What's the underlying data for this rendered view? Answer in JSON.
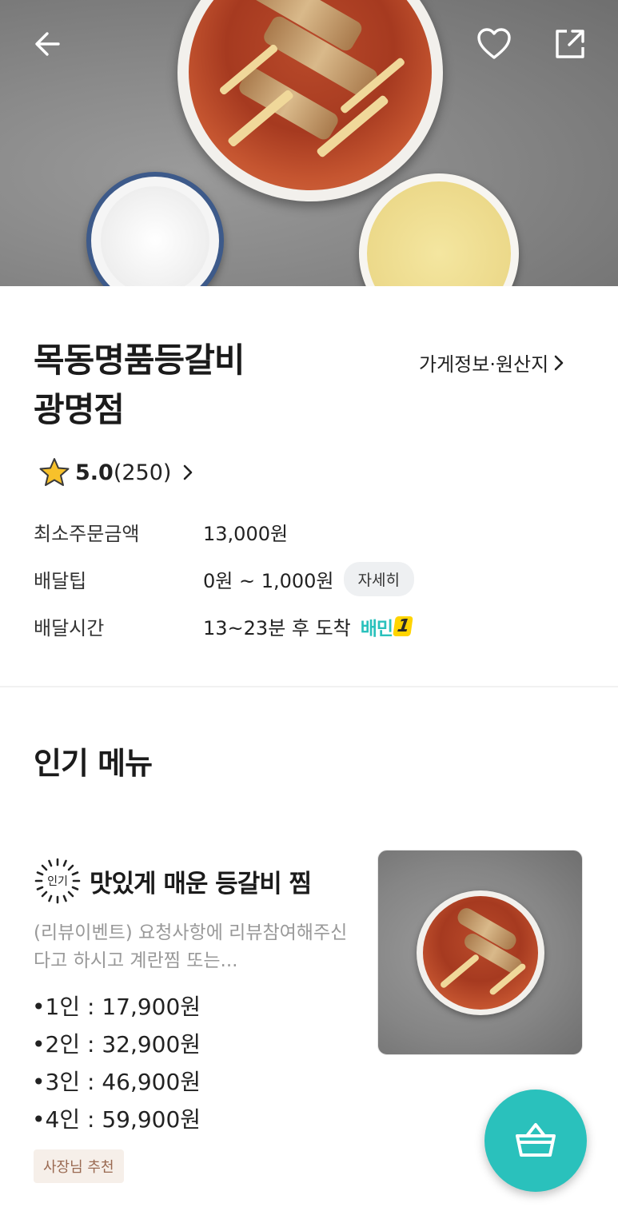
{
  "hero": {
    "back_icon": "arrow-left-icon",
    "favorite_icon": "heart-icon",
    "share_icon": "share-icon"
  },
  "store": {
    "name_line1": "목동명품등갈비",
    "name_line2": "광명점",
    "info_link_label": "가게정보·원산지",
    "rating_score": "5.0",
    "rating_count": "(250)"
  },
  "info": {
    "min_order_label": "최소주문금액",
    "min_order_value": "13,000원",
    "delivery_tip_label": "배달팁",
    "delivery_tip_value": "0원 ~ 1,000원",
    "detail_button": "자세히",
    "delivery_time_label": "배달시간",
    "delivery_time_value": "13~23분 후 도착",
    "baemin1_text": "배민",
    "baemin1_num": "1"
  },
  "popular": {
    "section_title": "인기 메뉴",
    "badge_label": "인기",
    "menu_title": "맛있게 매운 등갈비 찜",
    "description": "(리뷰이벤트) 요청사항에 리뷰참여해주신다고 하시고 계란찜 또는...",
    "prices": [
      "•1인 : 17,900원",
      "•2인 : 32,900원",
      "•3인 : 46,900원",
      "•4인 : 59,900원"
    ],
    "owner_tag": "사장님 추천"
  },
  "colors": {
    "accent": "#2ac1bc",
    "star": "#f7c12b"
  },
  "cart": {
    "icon": "shopping-basket-icon"
  }
}
